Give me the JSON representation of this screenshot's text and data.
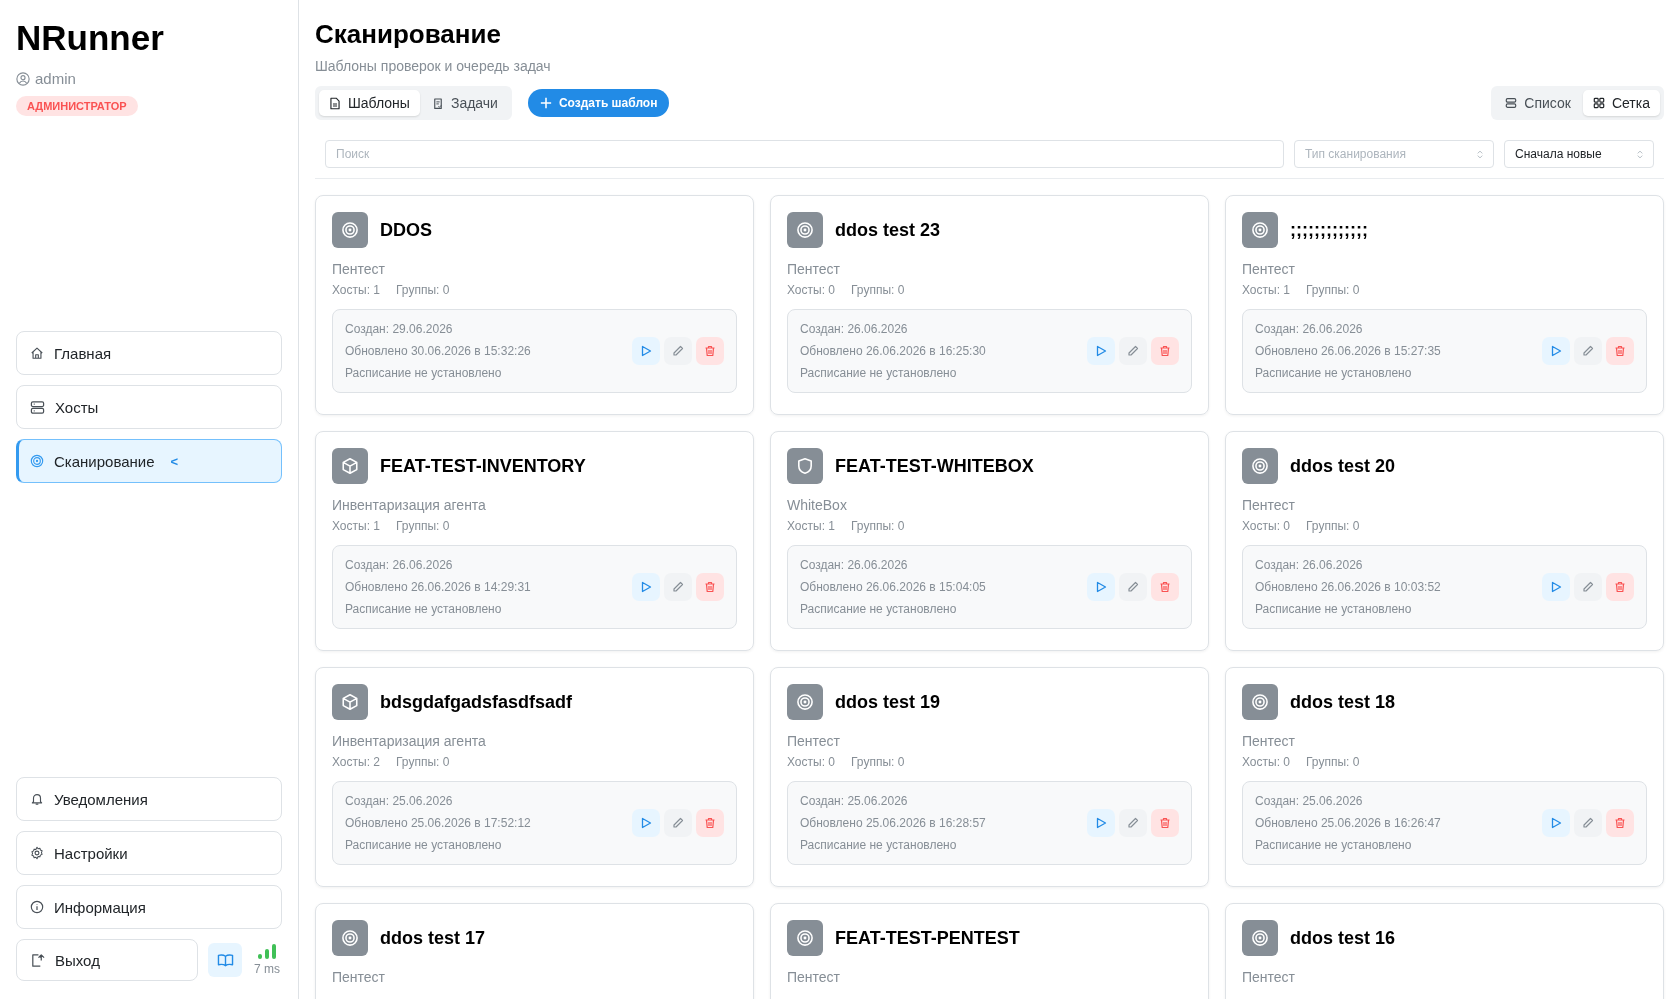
{
  "sidebar": {
    "app_name": "NRunner",
    "user": "admin",
    "role": "АДМИНИСТРАТОР",
    "nav": [
      {
        "label": "Главная",
        "kind": "home",
        "selected": false
      },
      {
        "label": "Хосты",
        "kind": "server",
        "selected": false
      },
      {
        "label": "Сканирование",
        "kind": "target",
        "selected": true,
        "marker": "<"
      }
    ],
    "bottom_nav": [
      {
        "label": "Уведомления",
        "kind": "bell"
      },
      {
        "label": "Настройки",
        "kind": "gear"
      },
      {
        "label": "Информация",
        "kind": "info"
      }
    ],
    "logout": "Выход",
    "ping": "7 ms"
  },
  "page": {
    "title": "Сканирование",
    "subtitle": "Шаблоны проверок и очередь задач"
  },
  "tabs": [
    {
      "label": "Шаблоны",
      "kind": "file",
      "selected": true
    },
    {
      "label": "Задачи",
      "kind": "clipboard",
      "selected": false
    }
  ],
  "create_button": "Создать шаблон",
  "view_modes": [
    {
      "label": "Список",
      "kind": "list",
      "selected": false
    },
    {
      "label": "Сетка",
      "kind": "grid",
      "selected": true
    }
  ],
  "filters": {
    "search": {
      "placeholder": "Поиск"
    },
    "scan_type": {
      "placeholder": "Тип сканирования"
    },
    "sort": {
      "value": "Сначала новые"
    }
  },
  "cards": [
    {
      "kind": "target",
      "title": "DDOS",
      "type": "Пентест",
      "hosts": "Хосты: 1",
      "groups": "Группы: 0",
      "created": "Создан: 29.06.2026",
      "updated": "Обновлено 30.06.2026 в 15:32:26",
      "schedule": "Расписание не установлено"
    },
    {
      "kind": "target",
      "title": "ddos test 23",
      "type": "Пентест",
      "hosts": "Хосты: 0",
      "groups": "Группы: 0",
      "created": "Создан: 26.06.2026",
      "updated": "Обновлено 26.06.2026 в 16:25:30",
      "schedule": "Расписание не установлено"
    },
    {
      "kind": "target",
      "title": ";;;;;;;;;;;;;",
      "type": "Пентест",
      "hosts": "Хосты: 1",
      "groups": "Группы: 0",
      "created": "Создан: 26.06.2026",
      "updated": "Обновлено 26.06.2026 в 15:27:35",
      "schedule": "Расписание не установлено"
    },
    {
      "kind": "cube",
      "title": "FEAT-TEST-INVENTORY",
      "type": "Инвентаризация агента",
      "hosts": "Хосты: 1",
      "groups": "Группы: 0",
      "created": "Создан: 26.06.2026",
      "updated": "Обновлено 26.06.2026 в 14:29:31",
      "schedule": "Расписание не установлено"
    },
    {
      "kind": "shield",
      "title": "FEAT-TEST-WHITEBOX",
      "type": "WhiteBox",
      "hosts": "Хосты: 1",
      "groups": "Группы: 0",
      "created": "Создан: 26.06.2026",
      "updated": "Обновлено 26.06.2026 в 15:04:05",
      "schedule": "Расписание не установлено"
    },
    {
      "kind": "target",
      "title": "ddos test 20",
      "type": "Пентест",
      "hosts": "Хосты: 0",
      "groups": "Группы: 0",
      "created": "Создан: 26.06.2026",
      "updated": "Обновлено 26.06.2026 в 10:03:52",
      "schedule": "Расписание не установлено"
    },
    {
      "kind": "cube",
      "title": "bdsgdafgadsfasdfsadf",
      "type": "Инвентаризация агента",
      "hosts": "Хосты: 2",
      "groups": "Группы: 0",
      "created": "Создан: 25.06.2026",
      "updated": "Обновлено 25.06.2026 в 17:52:12",
      "schedule": "Расписание не установлено"
    },
    {
      "kind": "target",
      "title": "ddos test 19",
      "type": "Пентест",
      "hosts": "Хосты: 0",
      "groups": "Группы: 0",
      "created": "Создан: 25.06.2026",
      "updated": "Обновлено 25.06.2026 в 16:28:57",
      "schedule": "Расписание не установлено"
    },
    {
      "kind": "target",
      "title": "ddos test 18",
      "type": "Пентест",
      "hosts": "Хосты: 0",
      "groups": "Группы: 0",
      "created": "Создан: 25.06.2026",
      "updated": "Обновлено 25.06.2026 в 16:26:47",
      "schedule": "Расписание не установлено"
    },
    {
      "kind": "target",
      "title": "ddos test 17",
      "type": "Пентест"
    },
    {
      "kind": "target",
      "title": "FEAT-TEST-PENTEST",
      "type": "Пентест"
    },
    {
      "kind": "target",
      "title": "ddos test 16",
      "type": "Пентест"
    }
  ]
}
